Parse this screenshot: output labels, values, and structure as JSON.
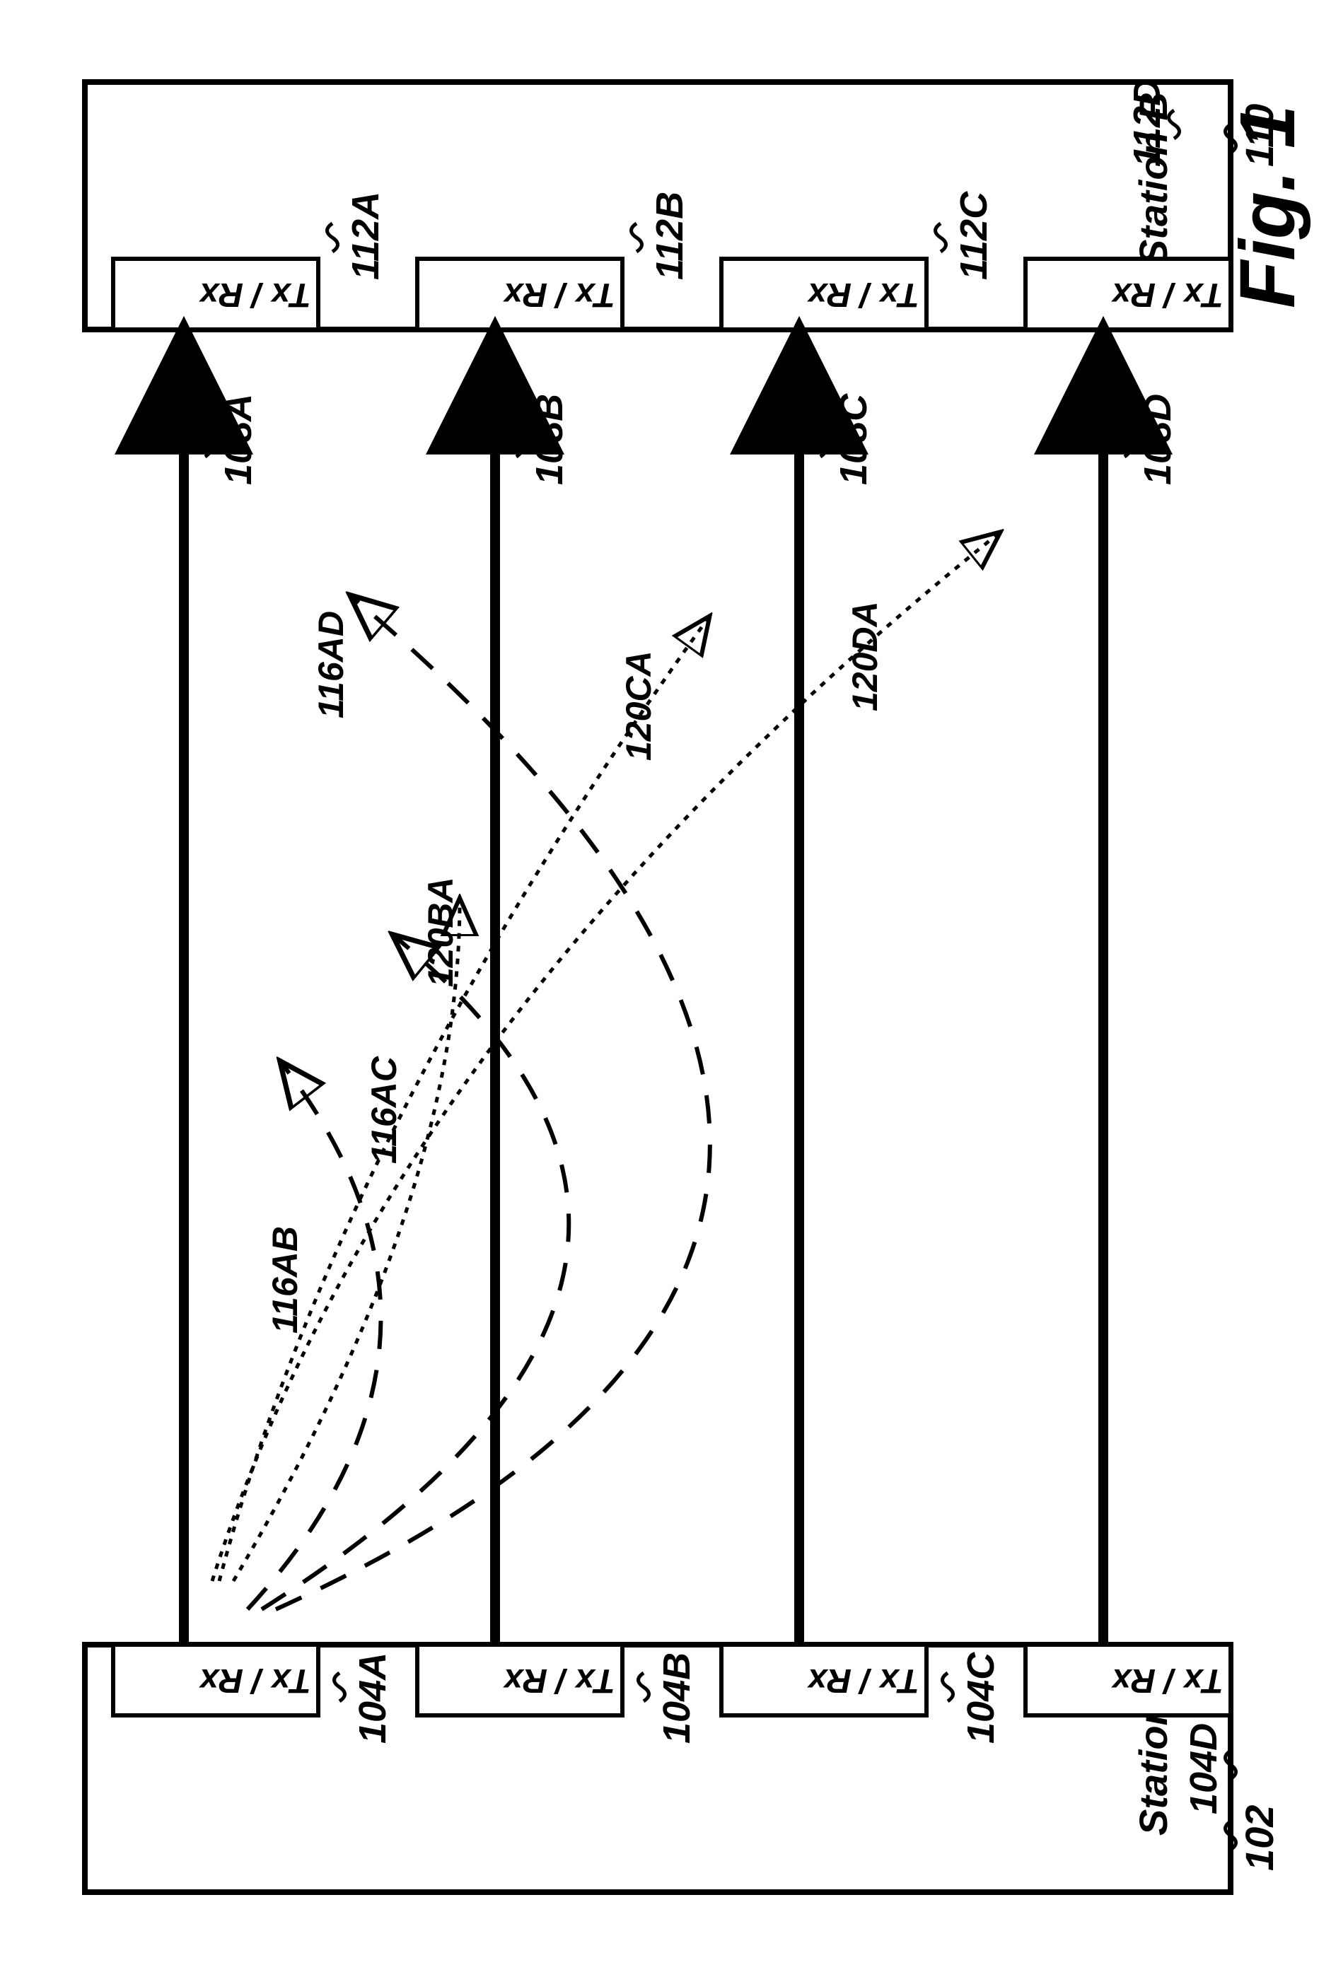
{
  "figure_label": "Fig. 1",
  "stationA": {
    "label": "Station A",
    "ref": "102"
  },
  "stationB": {
    "label": "Station B",
    "ref": "110"
  },
  "txrx": {
    "label": "Tx / Rx"
  },
  "a_units": {
    "a": {
      "ref": "104A"
    },
    "b": {
      "ref": "104B"
    },
    "c": {
      "ref": "104C"
    },
    "d": {
      "ref": "104D"
    }
  },
  "b_units": {
    "a": {
      "ref": "112A"
    },
    "b": {
      "ref": "112B"
    },
    "c": {
      "ref": "112C"
    },
    "d": {
      "ref": "112D"
    }
  },
  "links": {
    "a": {
      "ref": "108A"
    },
    "b": {
      "ref": "108B"
    },
    "c": {
      "ref": "108C"
    },
    "d": {
      "ref": "108D"
    }
  },
  "crosstalk_dashed": {
    "ab": "116AB",
    "ac": "116AC",
    "ad": "116AD"
  },
  "crosstalk_dotted": {
    "ba": "120BA",
    "ca": "120CA",
    "da": "120DA"
  }
}
